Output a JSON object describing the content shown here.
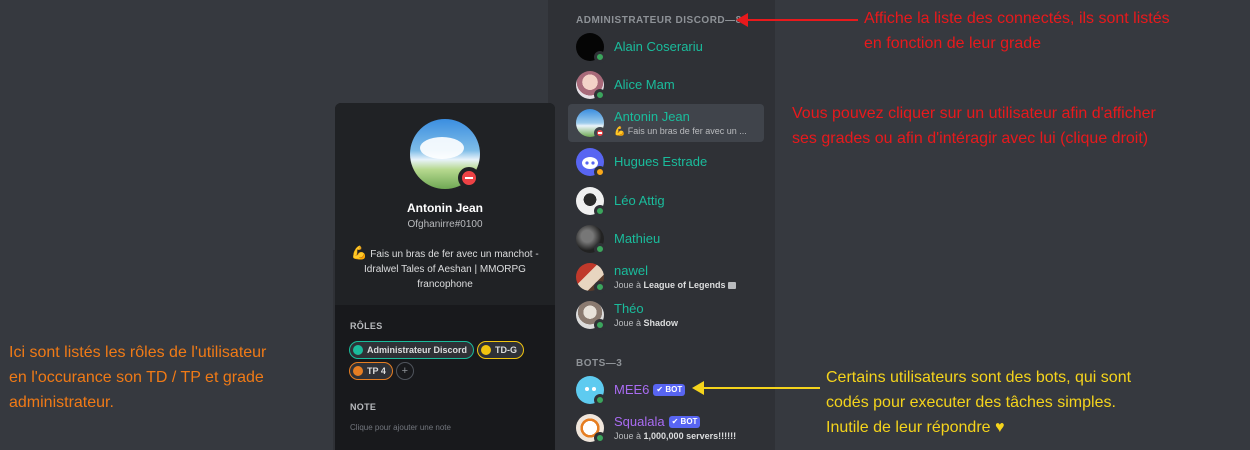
{
  "member_list": {
    "admin_header": "ADMINISTRATEUR DISCORD—8",
    "admins": [
      {
        "name": "Alain Coserariu",
        "status": "online",
        "activity": ""
      },
      {
        "name": "Alice Mam",
        "status": "online",
        "activity": ""
      },
      {
        "name": "Antonin Jean",
        "status": "dnd",
        "activity": "💪 Fais un bras de fer avec un ...",
        "selected": true
      },
      {
        "name": "Hugues Estrade",
        "status": "idle",
        "activity": ""
      },
      {
        "name": "Léo Attig",
        "status": "online",
        "activity": ""
      },
      {
        "name": "Mathieu",
        "status": "online",
        "activity": ""
      },
      {
        "name": "nawel",
        "status": "online",
        "activity_prefix": "Joue à ",
        "activity_bold": "League of Legends"
      },
      {
        "name": "Théo",
        "status": "online",
        "activity_prefix": "Joue à ",
        "activity_bold": "Shadow"
      }
    ],
    "bots_header": "BOTS—3",
    "bots": [
      {
        "name": "MEE6",
        "tag": "✔ BOT",
        "activity": ""
      },
      {
        "name": "Squalala",
        "tag": "✔ BOT",
        "activity_prefix": "Joue à ",
        "activity_bold": "1,000,000 servers!!!!!!"
      }
    ]
  },
  "popout": {
    "name": "Antonin Jean",
    "tag": "Ofghanirre#0100",
    "status_emoji": "💪",
    "status_text": "Fais un bras de fer avec un manchot - Idralwel Tales of Aeshan | MMORPG francophone",
    "roles_title": "RÔLES",
    "roles": [
      {
        "label": "Administrateur Discord",
        "color": "#1abc9c"
      },
      {
        "label": "TD-G",
        "color": "#f1c40f"
      },
      {
        "label": "TP 4",
        "color": "#e67e22"
      }
    ],
    "add_role": "+",
    "note_title": "NOTE",
    "note_placeholder": "Clique pour ajouter une note"
  },
  "annotations": {
    "members_line1": "Affiche la liste des connectés, ils sont listés",
    "members_line2": "en fonction de leur grade",
    "click_line1": "Vous pouvez cliquer sur un utilisateur afin d'afficher",
    "click_line2": "ses grades ou afin d'intéragir avec lui (clique droit)",
    "roles_line1": "Ici sont listés les rôles de l'utilisateur",
    "roles_line2": "en l'occurance son TD / TP et grade",
    "roles_line3": "administrateur.",
    "bots_line1": "Certains utilisateurs sont des bots, qui sont",
    "bots_line2": "codés pour executer des tâches simples.",
    "bots_line3": "Inutile de leur répondre ♥"
  },
  "colors": {
    "background": "#36393f",
    "sidebar": "#2f3136",
    "admin_name": "#1abc9c",
    "bot_name": "#a96cf2",
    "annotation_red": "#e8191c",
    "annotation_orange": "#f07a16",
    "annotation_yellow": "#f5d41c"
  }
}
